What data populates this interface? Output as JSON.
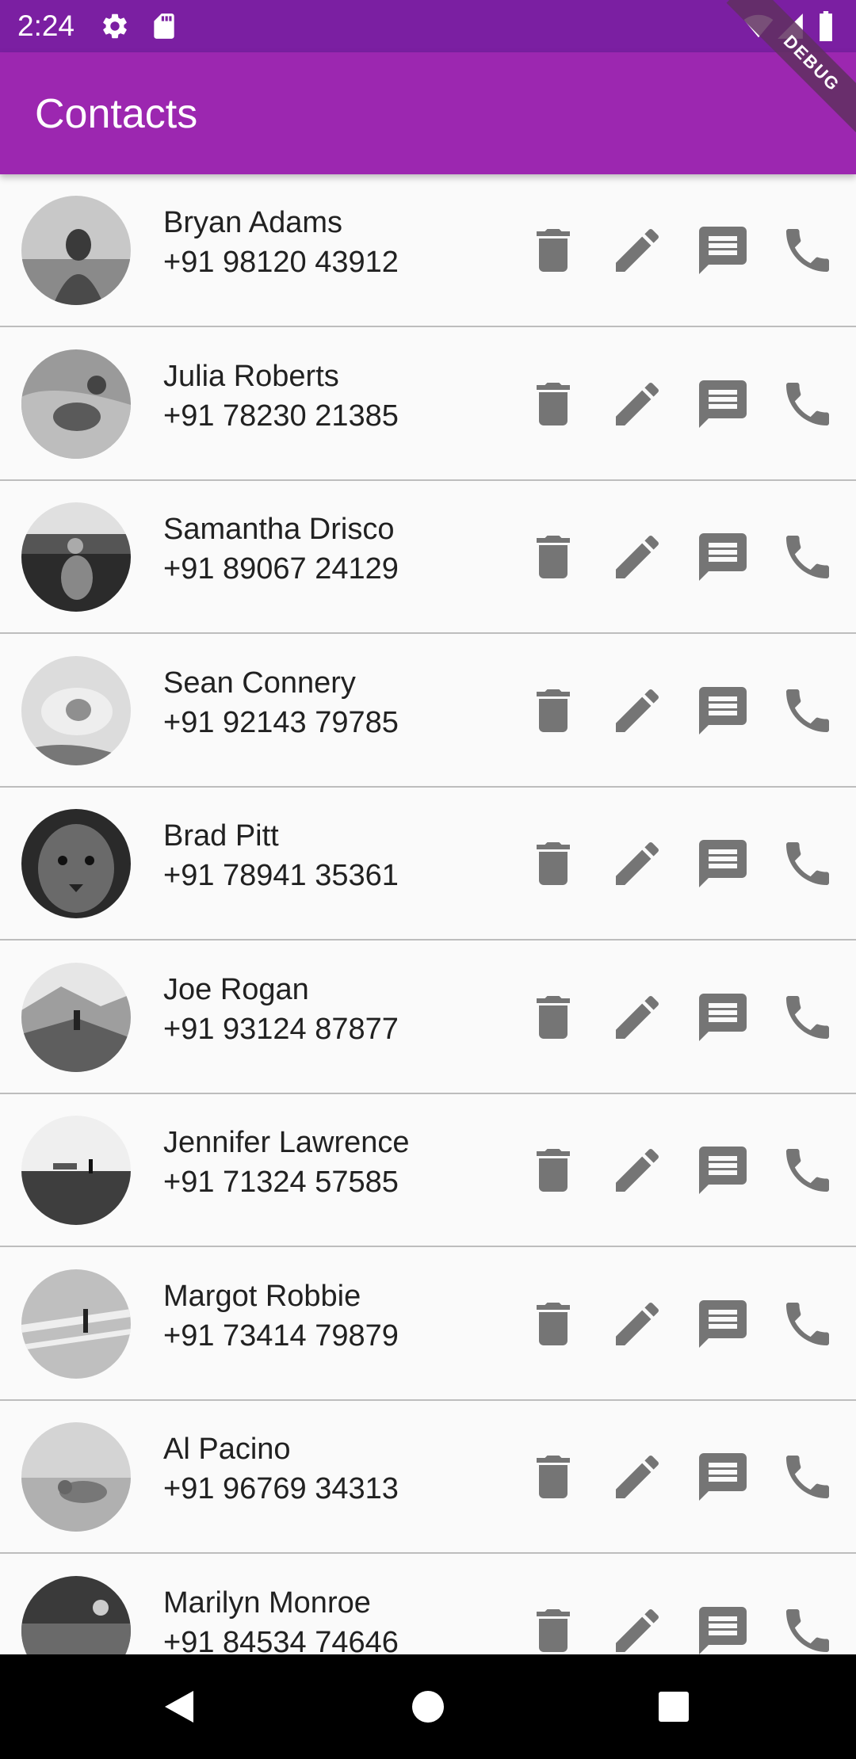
{
  "status_bar": {
    "time": "2:24",
    "icons": [
      "gear-icon",
      "sd-card-icon",
      "wifi-icon",
      "signal-icon",
      "battery-icon"
    ]
  },
  "app_bar": {
    "title": "Contacts",
    "background": "#9C27B0",
    "status_background": "#7B1FA2"
  },
  "debug_banner": "DEBUG",
  "contacts": [
    {
      "name": "Bryan Adams",
      "phone": "+91 98120 43912"
    },
    {
      "name": "Julia Roberts",
      "phone": "+91 78230 21385"
    },
    {
      "name": "Samantha Drisco",
      "phone": "+91 89067 24129"
    },
    {
      "name": "Sean Connery",
      "phone": "+91 92143 79785"
    },
    {
      "name": "Brad Pitt",
      "phone": "+91 78941 35361"
    },
    {
      "name": "Joe Rogan",
      "phone": "+91 93124 87877"
    },
    {
      "name": "Jennifer Lawrence",
      "phone": "+91 71324 57585"
    },
    {
      "name": "Margot Robbie",
      "phone": "+91 73414 79879"
    },
    {
      "name": "Al Pacino",
      "phone": "+91 96769 34313"
    },
    {
      "name": "Marilyn Monroe",
      "phone": "+91 84534 74646"
    }
  ],
  "row_actions": [
    "delete-icon",
    "edit-icon",
    "message-icon",
    "call-icon"
  ],
  "icon_color": "#757575",
  "nav_bar": [
    "back-icon",
    "home-icon",
    "recents-icon"
  ]
}
